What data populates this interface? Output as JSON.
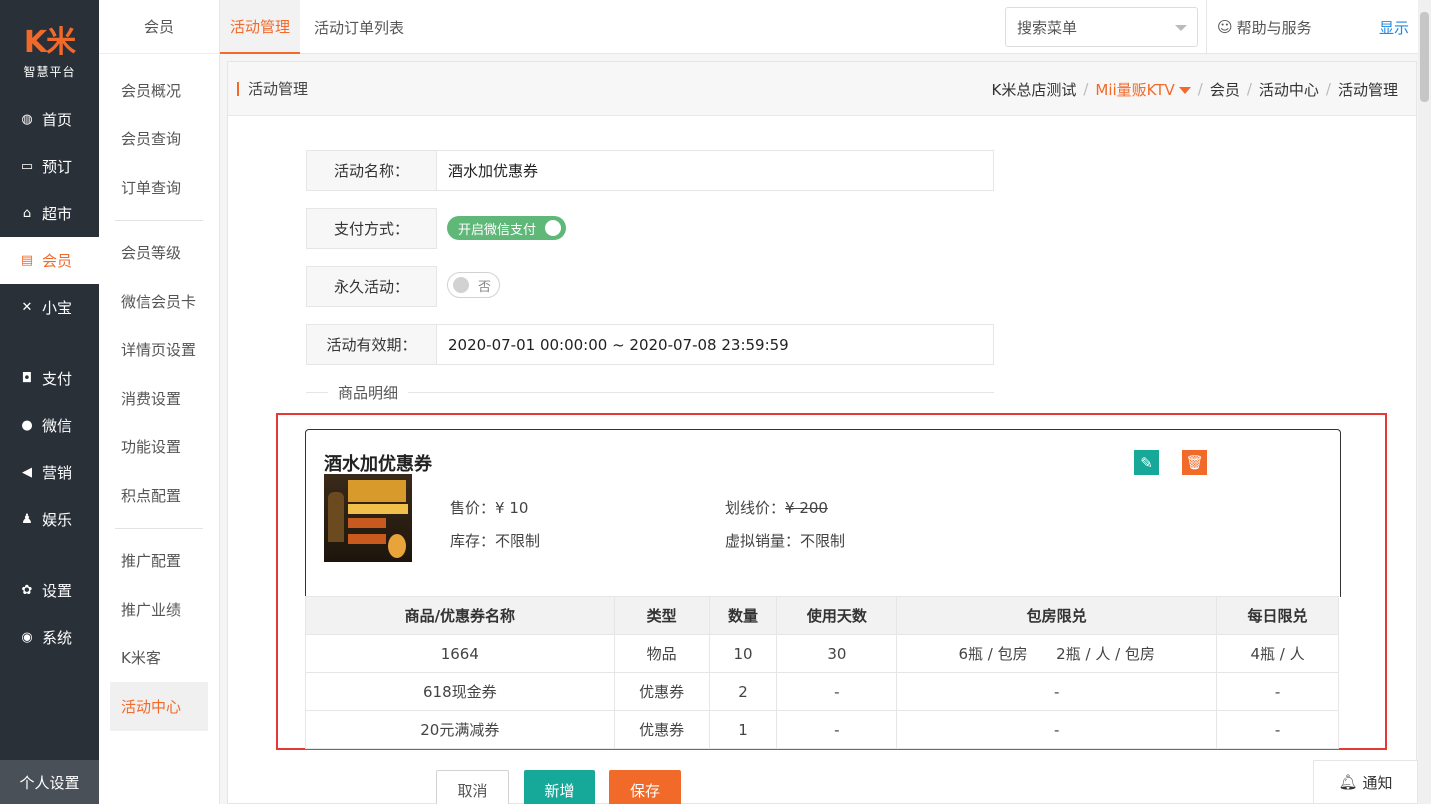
{
  "logo": {
    "mark": "K米",
    "subtitle": "智慧平台"
  },
  "sidebar": {
    "items": [
      {
        "icon": "dashboard-icon",
        "glyph": "◍",
        "label": "首页"
      },
      {
        "icon": "calendar-icon",
        "glyph": "▭",
        "label": "预订"
      },
      {
        "icon": "basket-icon",
        "glyph": "⌂",
        "label": "超市"
      },
      {
        "icon": "card-icon",
        "glyph": "▤",
        "label": "会员",
        "active": true
      },
      {
        "icon": "xiaobao-icon",
        "glyph": "✕",
        "label": "小宝"
      },
      {
        "icon": "money-icon",
        "glyph": "◘",
        "label": "支付"
      },
      {
        "icon": "wechat-icon",
        "glyph": "●",
        "label": "微信"
      },
      {
        "icon": "megaphone-icon",
        "glyph": "◀",
        "label": "营销"
      },
      {
        "icon": "game-icon",
        "glyph": "♟",
        "label": "娱乐"
      },
      {
        "icon": "gear-icon",
        "glyph": "✿",
        "label": "设置"
      },
      {
        "icon": "system-icon",
        "glyph": "◉",
        "label": "系统"
      }
    ],
    "bottom": "个人设置"
  },
  "submenu": {
    "head": "会员",
    "group1": [
      "会员概况",
      "会员查询",
      "订单查询"
    ],
    "group2": [
      "会员等级",
      "微信会员卡",
      "详情页设置",
      "消费设置",
      "功能设置",
      "积点配置"
    ],
    "group3": [
      "推广配置",
      "推广业绩",
      "K米客"
    ],
    "active": "活动中心"
  },
  "topbar": {
    "tabs": [
      "活动管理",
      "活动订单列表"
    ],
    "search_placeholder": "搜索菜单",
    "help": "帮助与服务",
    "show": "显示"
  },
  "breadcrumb": {
    "title": "活动管理",
    "items": [
      "K米总店测试",
      "Mii量贩KTV",
      "会员",
      "活动中心",
      "活动管理"
    ]
  },
  "form": {
    "name_label": "活动名称：",
    "name_value": "酒水加优惠券",
    "pay_label": "支付方式：",
    "pay_toggle": "开启微信支付",
    "forever_label": "永久活动：",
    "forever_toggle": "否",
    "period_label": "活动有效期：",
    "period_value": "2020-07-01 00:00:00 ~ 2020-07-08 23:59:59"
  },
  "section_title": "商品明细",
  "product": {
    "title": "酒水加优惠券",
    "price_label": "售价：",
    "price": "¥ 10",
    "strike_label": "划线价：",
    "strike_price": "¥ 200",
    "stock_label": "库存：",
    "stock": "不限制",
    "virtual_label": "虚拟销量：",
    "virtual": "不限制"
  },
  "table": {
    "headers": [
      "商品/优惠券名称",
      "类型",
      "数量",
      "使用天数",
      "包房限兑",
      "每日限兑"
    ],
    "rows": [
      [
        "1664",
        "物品",
        "10",
        "30",
        "6瓶 / 包房      2瓶 / 人 / 包房",
        "4瓶 / 人"
      ],
      [
        "618现金券",
        "优惠券",
        "2",
        "-",
        "-",
        "-"
      ],
      [
        "20元满减券",
        "优惠券",
        "1",
        "-",
        "-",
        "-"
      ]
    ]
  },
  "buttons": {
    "cancel": "取消",
    "add": "新增",
    "save": "保存"
  },
  "notify": "通知",
  "colors": {
    "accent": "#f26a2a",
    "teal": "#16a99a",
    "green": "#5fb878",
    "sidebar": "#293038",
    "highlight": "#e53935"
  }
}
